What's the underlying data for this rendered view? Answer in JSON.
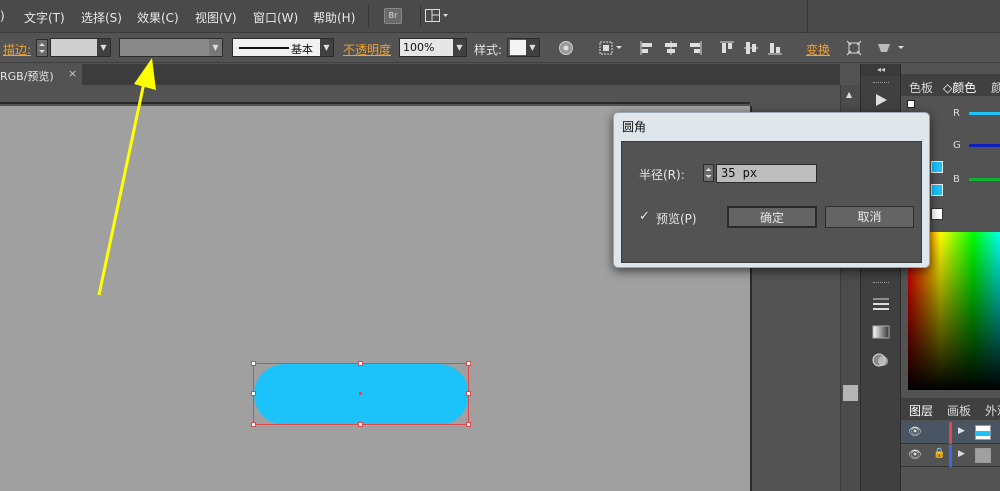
{
  "menubar": {
    "items": [
      "文字(T)",
      "选择(S)",
      "效果(C)",
      "视图(V)",
      "窗口(W)",
      "帮助(H)"
    ],
    "partial_left": ")",
    "bridge_label": "Br"
  },
  "controlbar": {
    "stroke_label": "描边:",
    "stroke_profile": "基本",
    "opacity_label": "不透明度",
    "opacity_value": "100%",
    "style_label": "样式:",
    "transform_label": "变换"
  },
  "document": {
    "tab_label": "RGB/预览)"
  },
  "panels": {
    "color_tabs": [
      "色板",
      "颜色",
      "颜"
    ],
    "channels": [
      "R",
      "G",
      "B"
    ],
    "layer_tabs": [
      "图层",
      "画板",
      "外观"
    ]
  },
  "dialog": {
    "title": "圆角",
    "radius_label": "半径(R):",
    "radius_value": "35 px",
    "preview_label": "预览(P)",
    "preview_checked": true,
    "ok_label": "确定",
    "cancel_label": "取消"
  },
  "colors": {
    "shape_fill": "#1cc3fb",
    "selection": "#e0484a",
    "annotation_arrow": "#ffff00",
    "accent_orange": "#f0a030"
  }
}
